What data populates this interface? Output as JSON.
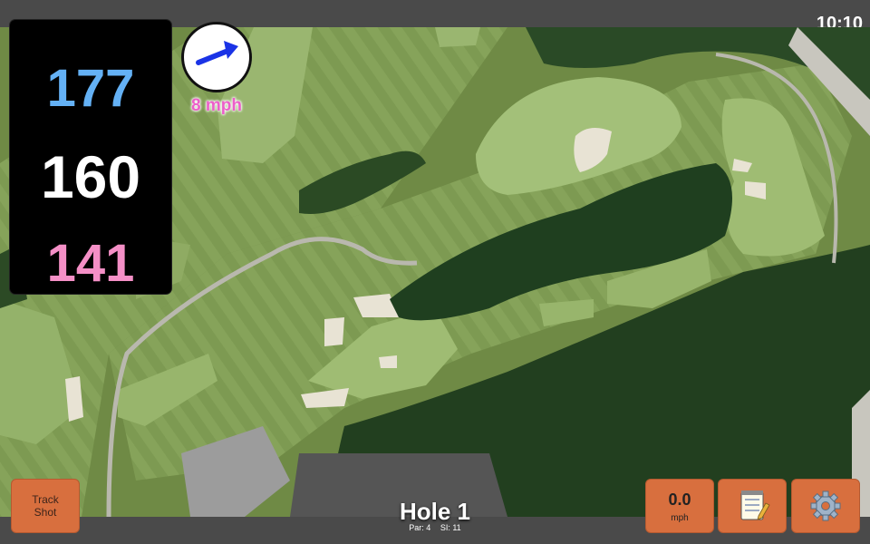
{
  "status": {
    "time": "10:10"
  },
  "yardages": {
    "back": "177",
    "middle": "160",
    "front": "141"
  },
  "wind": {
    "speed": "8 mph",
    "icon": "wind-arrow-icon"
  },
  "hole": {
    "title": "Hole 1",
    "par": "Par: 4",
    "si": "SI: 11"
  },
  "buttons": {
    "track_shot_line1": "Track",
    "track_shot_line2": "Shot",
    "speed_value": "0.0",
    "speed_unit": "mph",
    "notes_icon": "notepad-icon",
    "settings_icon": "gear-icon"
  },
  "colors": {
    "back_yardage": "#64b1f5",
    "middle_yardage": "#ffffff",
    "front_yardage": "#f48fc6",
    "button_orange": "#d86f3e",
    "wind_label": "#ec5fc9"
  }
}
